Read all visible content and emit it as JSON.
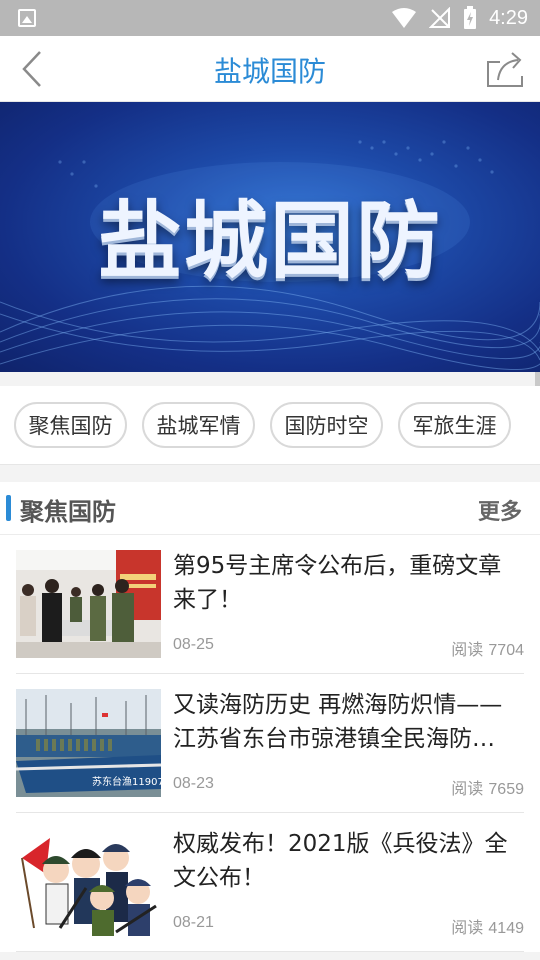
{
  "status_bar": {
    "time": "4:29"
  },
  "header": {
    "title": "盐城国防"
  },
  "banner": {
    "title": "盐城国防"
  },
  "tabs": [
    {
      "label": "聚焦国防"
    },
    {
      "label": "盐城军情"
    },
    {
      "label": "国防时空"
    },
    {
      "label": "军旅生涯"
    }
  ],
  "section": {
    "title": "聚焦国防",
    "more": "更多"
  },
  "news": [
    {
      "title": "第95号主席令公布后，重磅文章来了！",
      "date": "08-25",
      "reads_label": "阅读",
      "reads": "7704"
    },
    {
      "title": "又读海防历史 再燃海防炽情——江苏省东台市弶港镇全民海防…",
      "date": "08-23",
      "reads_label": "阅读",
      "reads": "7659"
    },
    {
      "title": "权威发布！2021版《兵役法》全文公布！",
      "date": "08-21",
      "reads_label": "阅读",
      "reads": "4149"
    }
  ],
  "thumb_text": {
    "boat": "苏东台渔11907"
  },
  "colors": {
    "accent": "#2b8bd6",
    "status_bar": "#b7b7b7",
    "banner_dark": "#142f86"
  }
}
